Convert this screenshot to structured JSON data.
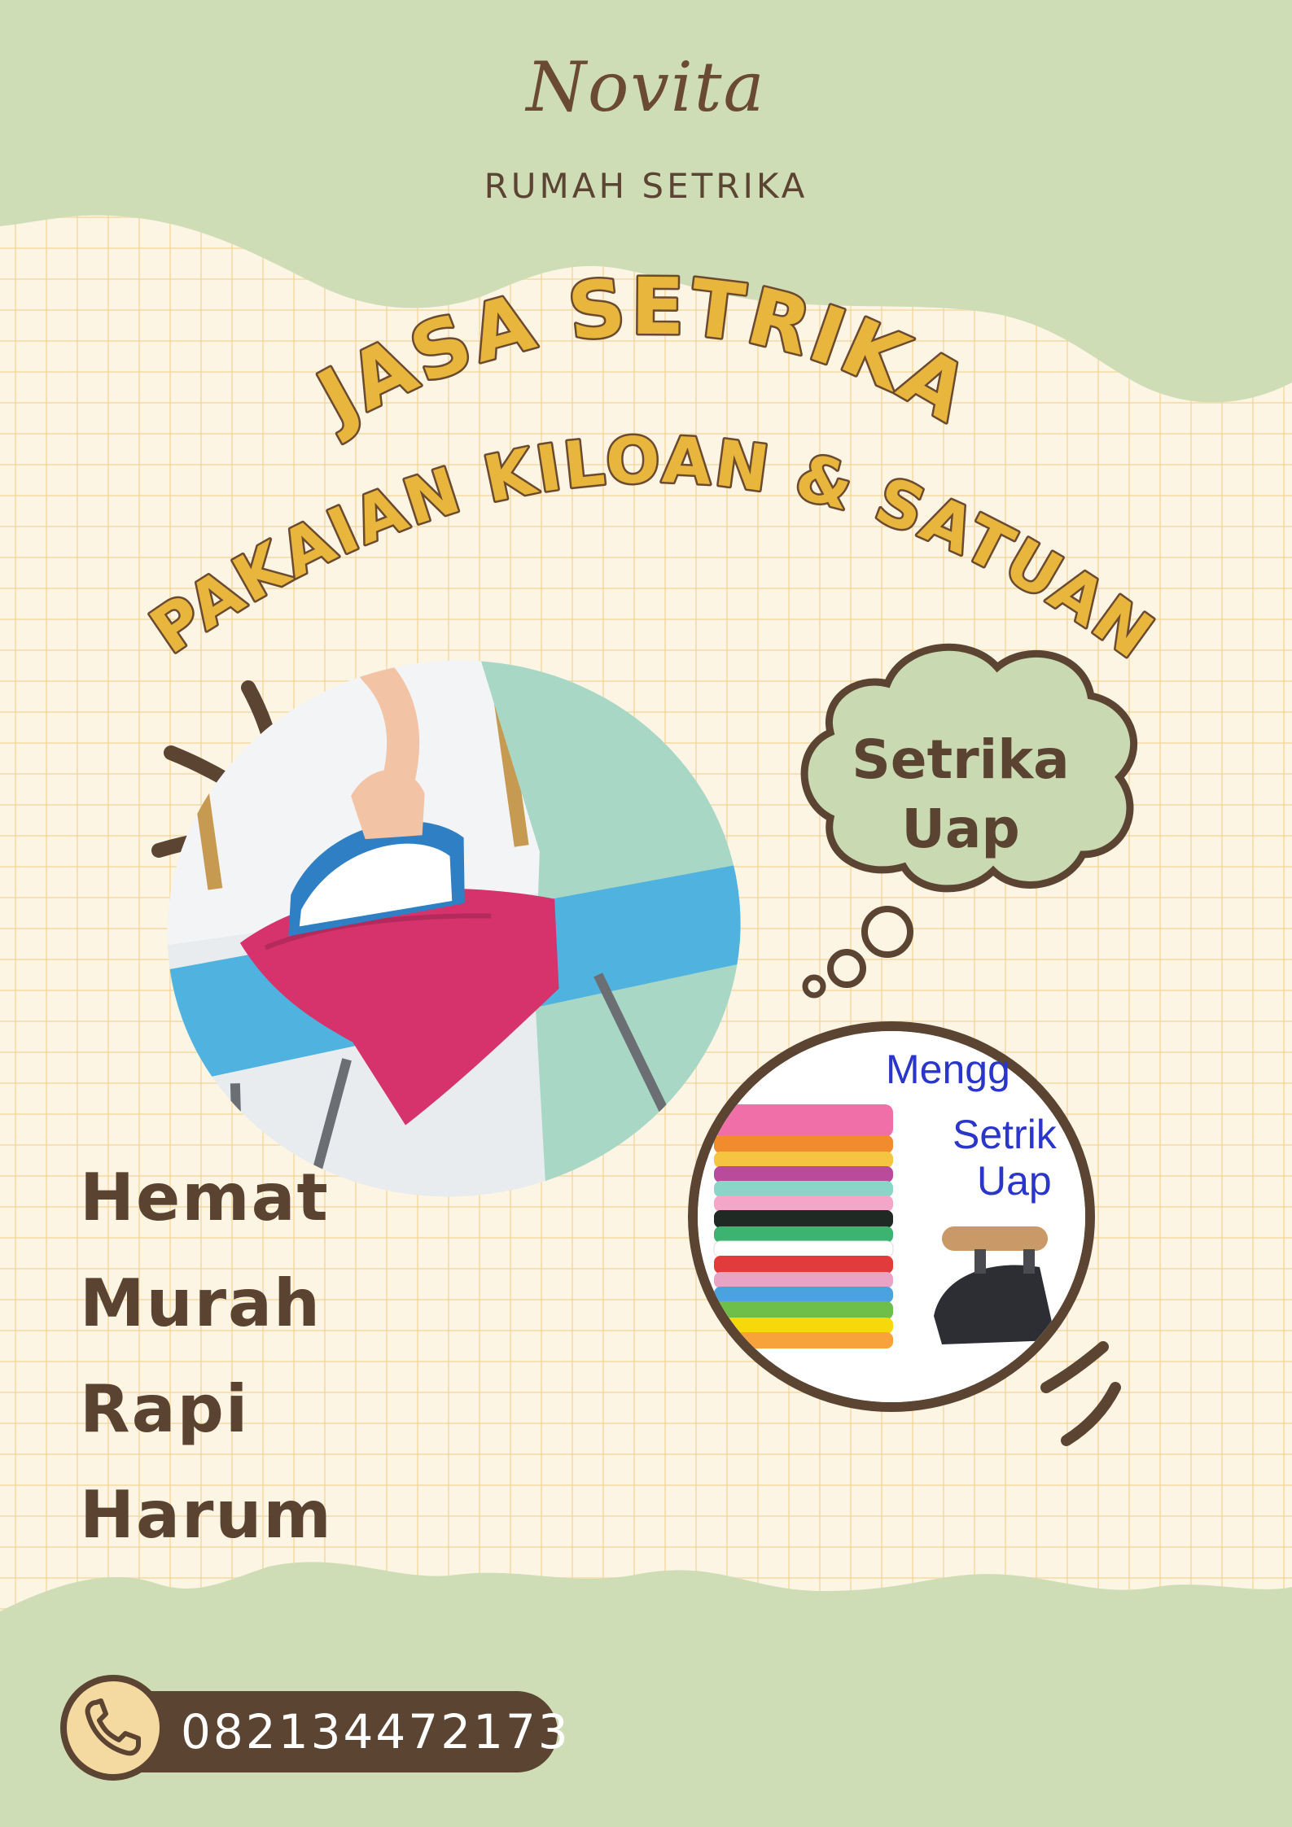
{
  "brand": {
    "name": "Novita",
    "subtitle": "RUMAH SETRIKA"
  },
  "headline": {
    "line1": "JASA SETRIKA",
    "line2": "PAKAIAN KILOAN & SATUAN"
  },
  "bubble": {
    "line1": "Setrika",
    "line2": "Uap"
  },
  "secondary_photo": {
    "caption_line1": "Mengg",
    "caption_line2": "Setrik",
    "caption_line3": "Uap"
  },
  "features": [
    "Hemat",
    "Murah",
    "Rapi",
    "Harum"
  ],
  "contact": {
    "phone": "082134472173",
    "icon": "phone-icon"
  },
  "colors": {
    "cream": "#fdf5e4",
    "sage": "#cfddb6",
    "brown": "#5c4433",
    "mustard": "#e8b53d"
  }
}
